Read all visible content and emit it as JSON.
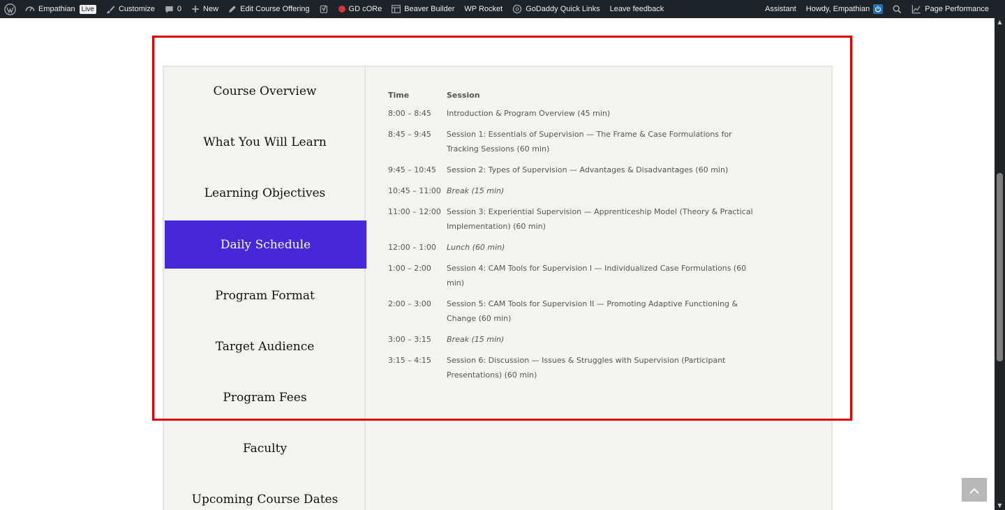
{
  "admin_bar": {
    "left_items": [
      {
        "name": "wp-logo",
        "label": ""
      },
      {
        "name": "site-name",
        "label": "Empathian",
        "badge": "Live"
      },
      {
        "name": "customize",
        "label": "Customize"
      },
      {
        "name": "comments",
        "label": "0"
      },
      {
        "name": "new",
        "label": "New"
      },
      {
        "name": "edit-course-offering",
        "label": "Edit Course Offering"
      },
      {
        "name": "yoast",
        "label": ""
      },
      {
        "name": "gd-core",
        "label": "GD cORe"
      },
      {
        "name": "beaver-builder",
        "label": "Beaver Builder"
      },
      {
        "name": "wp-rocket",
        "label": "WP Rocket"
      },
      {
        "name": "godaddy-quick-links",
        "label": "GoDaddy Quick Links"
      },
      {
        "name": "leave-feedback",
        "label": "Leave feedback"
      }
    ],
    "right_items": {
      "assistant": "Assistant",
      "howdy": "Howdy, Empathian",
      "page_performance": "Page Performance"
    }
  },
  "tabs": {
    "items": [
      {
        "label": "Course Overview",
        "active": false
      },
      {
        "label": "What You Will Learn",
        "active": false
      },
      {
        "label": "Learning Objectives",
        "active": false
      },
      {
        "label": "Daily Schedule",
        "active": true
      },
      {
        "label": "Program Format",
        "active": false
      },
      {
        "label": "Target Audience",
        "active": false
      },
      {
        "label": "Program Fees",
        "active": false
      },
      {
        "label": "Faculty",
        "active": false
      },
      {
        "label": "Upcoming Course Dates",
        "active": false
      }
    ]
  },
  "schedule": {
    "headers": {
      "time": "Time",
      "session": "Session"
    },
    "rows": [
      {
        "time": "8:00 – 8:45",
        "session": "Introduction & Program Overview (45 min)",
        "italic": false
      },
      {
        "time": "8:45 – 9:45",
        "session": "Session 1: Essentials of Supervision — The Frame & Case Formulations for Tracking Sessions  (60 min)",
        "italic": false
      },
      {
        "time": "9:45 – 10:45",
        "session": "Session 2: Types of Supervision — Advantages & Disadvantages  (60 min)",
        "italic": false
      },
      {
        "time": "10:45 – 11:00",
        "session": "Break (15 min)",
        "italic": true
      },
      {
        "time": "11:00 – 12:00",
        "session": "Session 3: Experiential Supervision — Apprenticeship Model (Theory & Practical Implementation) (60 min)",
        "italic": false
      },
      {
        "time": "12:00 – 1:00",
        "session": "Lunch (60 min)",
        "italic": true
      },
      {
        "time": "1:00 – 2:00",
        "session": "Session 4: CAM Tools for Supervision I — Individualized Case Formulations (60 min)",
        "italic": false
      },
      {
        "time": "2:00 – 3:00",
        "session": "Session 5: CAM Tools for Supervision II — Promoting Adaptive Functioning & Change (60 min)",
        "italic": false
      },
      {
        "time": "3:00 – 3:15",
        "session": "Break (15 min)",
        "italic": true
      },
      {
        "time": "3:15 – 4:15",
        "session": "Session 6: Discussion — Issues & Struggles with Supervision (Participant Presentations) (60 min)",
        "italic": false
      }
    ]
  },
  "colors": {
    "active_tab": "#4628d9",
    "highlight_border": "#e00000",
    "admin_bar": "#1d2327"
  }
}
